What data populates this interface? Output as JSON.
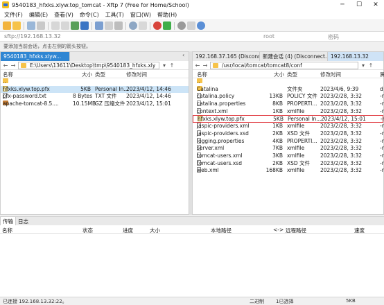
{
  "window": {
    "title": "9540183_hfxks.xlyw.top_tomcat - Xftp 7 (Free for Home/School)"
  },
  "menu": [
    "文件(F)",
    "编辑(E)",
    "查看(V)",
    "命令(C)",
    "工具(T)",
    "窗口(W)",
    "帮助(H)"
  ],
  "address": {
    "url": "sftp://192.168.13.32",
    "user_placeholder": "root",
    "password_placeholder": "密码"
  },
  "hint": "要添加当前会话，点击左侧的箭头按钮。",
  "left_pane": {
    "tab": "9540183_hfxks.xlyw...",
    "path": "E:\\Users\\13611\\Desktop\\tmp\\9540183_hfxks.xly",
    "columns": {
      "name": "名称",
      "size": "大小",
      "type": "类型",
      "modified": "修改时间"
    },
    "files": [
      {
        "name": "..",
        "size": "",
        "type": "",
        "modified": "",
        "icon": "folder-icon"
      },
      {
        "name": "hfxks.xlyw.top.pfx",
        "size": "5KB",
        "type": "Personal In...",
        "modified": "2023/4/12, 14:46",
        "icon": "certificate-icon"
      },
      {
        "name": "pfx-password.txt",
        "size": "8 Bytes",
        "type": "TXT 文件",
        "modified": "2023/4/12, 14:46",
        "icon": "text-file-icon"
      },
      {
        "name": "apache-tomcat-8.5....",
        "size": "10.15MB",
        "type": "GZ 压缩文件",
        "modified": "2023/4/12, 15:01",
        "icon": "archive-icon"
      }
    ]
  },
  "right_pane": {
    "tabs": [
      "192.168.37.165 (Disconn...",
      "新建会话 (4) (Disconnect...",
      "192.168.13.32"
    ],
    "path": "/usr/local/tomcat/tomcat8/conf",
    "columns": {
      "name": "名称",
      "size": "大小",
      "type": "类型",
      "modified": "修改时间",
      "extra": "属"
    },
    "files": [
      {
        "name": "..",
        "size": "",
        "type": "",
        "modified": "",
        "extra": "",
        "icon": "folder-icon"
      },
      {
        "name": "Catalina",
        "size": "",
        "type": "文件夹",
        "modified": "2023/4/6, 9:39",
        "extra": "d",
        "icon": "folder-icon"
      },
      {
        "name": "catalina.policy",
        "size": "13KB",
        "type": "POLICY 文件",
        "modified": "2023/2/28, 3:32",
        "extra": "-r",
        "icon": "file-icon"
      },
      {
        "name": "catalina.properties",
        "size": "8KB",
        "type": "PROPERTI...",
        "modified": "2023/2/28, 3:32",
        "extra": "-r",
        "icon": "file-icon"
      },
      {
        "name": "context.xml",
        "size": "1KB",
        "type": "xmlfile",
        "modified": "2023/2/28, 3:32",
        "extra": "-r",
        "icon": "file-icon"
      },
      {
        "name": "hfxks.xlyw.top.pfx",
        "size": "5KB",
        "type": "Personal In...",
        "modified": "2023/4/12, 15:01",
        "extra": "-r",
        "icon": "certificate-icon"
      },
      {
        "name": "jaspic-providers.xml",
        "size": "1KB",
        "type": "xmlfile",
        "modified": "2023/2/28, 3:32",
        "extra": "-r",
        "icon": "file-icon"
      },
      {
        "name": "jaspic-providers.xsd",
        "size": "2KB",
        "type": "XSD 文件",
        "modified": "2023/2/28, 3:32",
        "extra": "-r",
        "icon": "file-icon"
      },
      {
        "name": "logging.properties",
        "size": "4KB",
        "type": "PROPERTI...",
        "modified": "2023/2/28, 3:32",
        "extra": "-r",
        "icon": "file-icon"
      },
      {
        "name": "server.xml",
        "size": "7KB",
        "type": "xmlfile",
        "modified": "2023/2/28, 3:32",
        "extra": "-r",
        "icon": "file-icon"
      },
      {
        "name": "tomcat-users.xml",
        "size": "3KB",
        "type": "xmlfile",
        "modified": "2023/2/28, 3:32",
        "extra": "-r",
        "icon": "file-icon"
      },
      {
        "name": "tomcat-users.xsd",
        "size": "2KB",
        "type": "XSD 文件",
        "modified": "2023/2/28, 3:32",
        "extra": "-r",
        "icon": "file-icon"
      },
      {
        "name": "web.xml",
        "size": "168KB",
        "type": "xmlfile",
        "modified": "2023/2/28, 3:32",
        "extra": "-r",
        "icon": "file-icon"
      }
    ]
  },
  "transfer": {
    "tabs": [
      "传输",
      "日志"
    ],
    "columns": [
      "名称",
      "状态",
      "进度",
      "大小",
      "本地路径",
      "<->",
      "远程路径",
      "速度"
    ]
  },
  "status": {
    "connection": "已连接 192.168.13.32:22。",
    "mode": "二进制",
    "selected": "1已选择",
    "size": "5KB"
  },
  "colors": {
    "accent": "#2f86d3",
    "highlight": "#e0383e",
    "selection": "#cce4f7"
  }
}
